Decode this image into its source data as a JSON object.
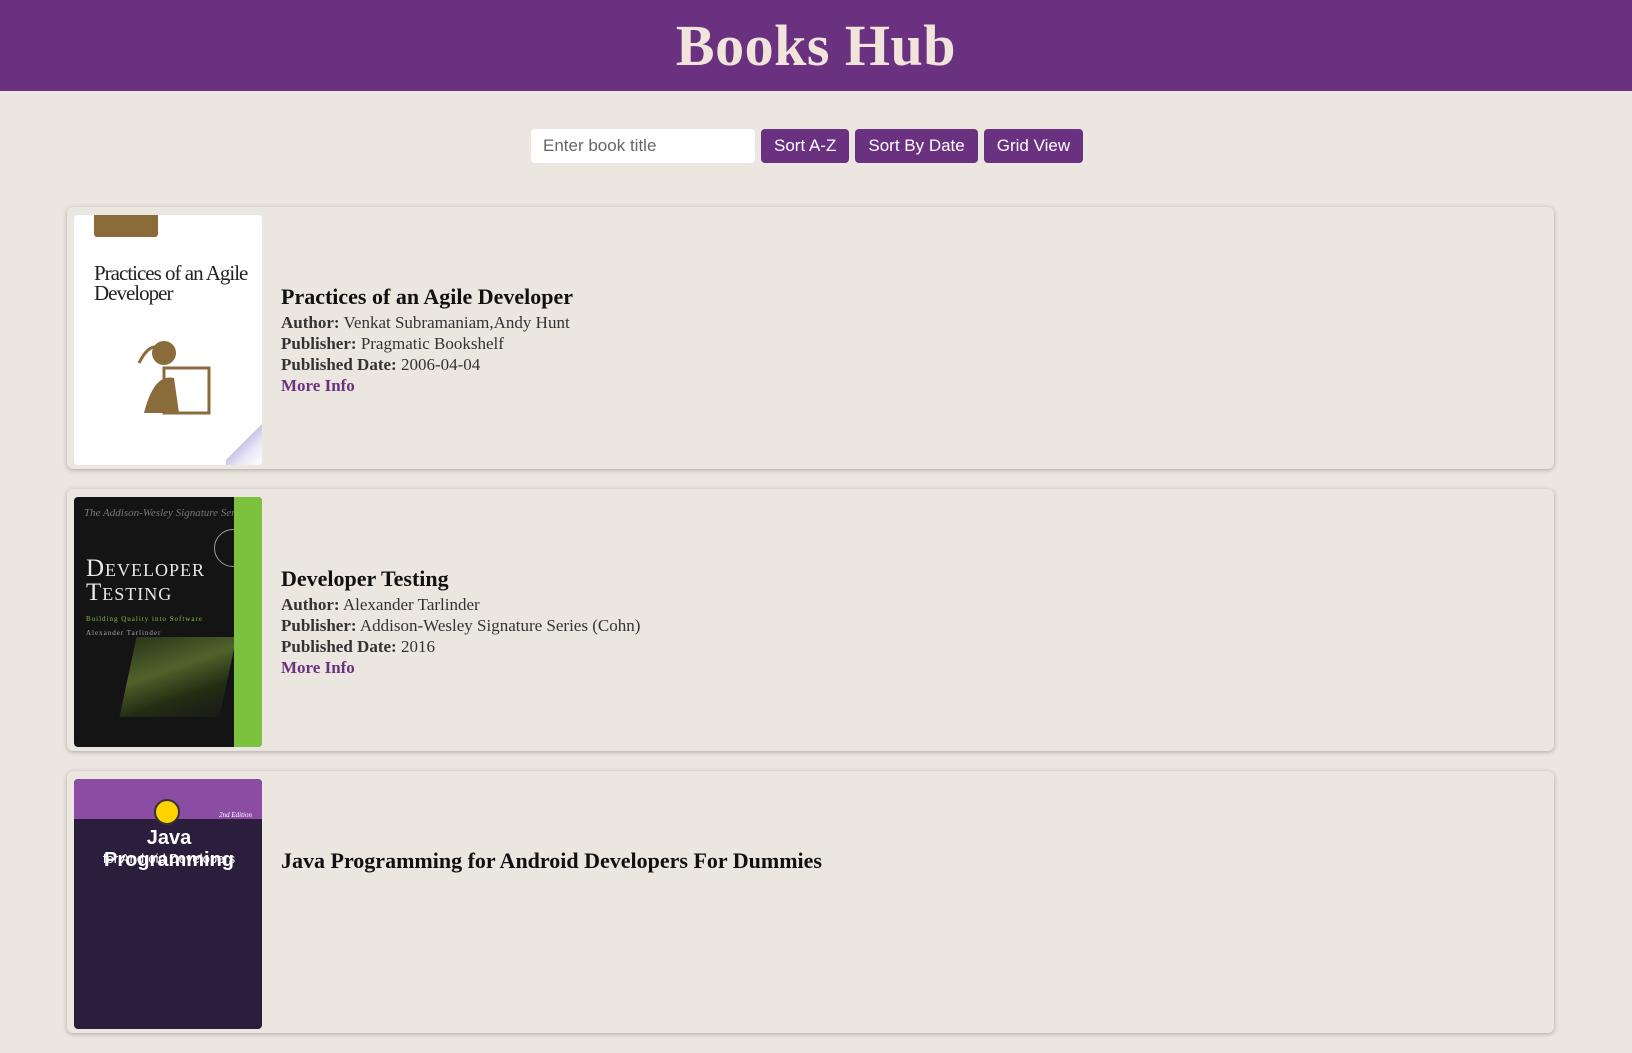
{
  "header": {
    "title": "Books Hub"
  },
  "controls": {
    "search_placeholder": "Enter book title",
    "sort_az_label": "Sort A-Z",
    "sort_date_label": "Sort By Date",
    "grid_view_label": "Grid View"
  },
  "labels": {
    "author": "Author:",
    "publisher": "Publisher:",
    "published_date": "Published Date:",
    "more_info": "More Info"
  },
  "books": [
    {
      "title": "Practices of an Agile Developer",
      "author": "Venkat Subramaniam,Andy Hunt",
      "publisher": "Pragmatic Bookshelf",
      "published_date": "2006-04-04",
      "cover_text": "Practices of an Agile Developer"
    },
    {
      "title": "Developer Testing",
      "author": "Alexander Tarlinder",
      "publisher": "Addison-Wesley Signature Series (Cohn)",
      "published_date": "2016",
      "cover_series": "The Addison-Wesley Signature Series",
      "cover_text": "Developer Testing",
      "cover_subtitle": "Building Quality into Software",
      "cover_author": "Alexander Tarlinder"
    },
    {
      "title": "Java Programming for Android Developers For Dummies",
      "author": "",
      "publisher": "",
      "published_date": "",
      "cover_text": "Java Programming",
      "cover_subtitle": "for Android Developers",
      "cover_edition": "2nd Edition"
    }
  ],
  "colors": {
    "brand": "#6a3180",
    "background": "#ece6e0",
    "title_text": "#f1e4da"
  }
}
